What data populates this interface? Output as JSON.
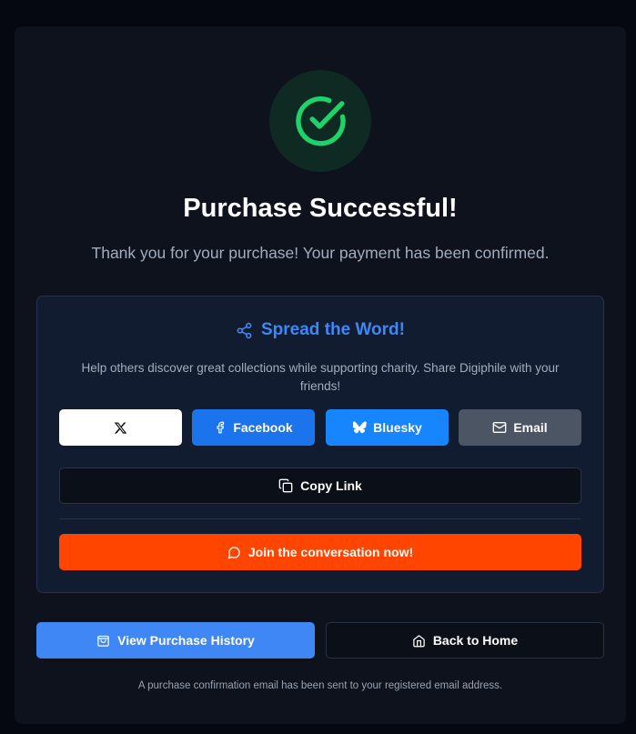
{
  "colors": {
    "success": "#1fd26a",
    "accent_blue": "#3f87f5",
    "facebook": "#1c74ec",
    "bluesky": "#1785fe",
    "email": "#4b5563",
    "join": "#ff4500"
  },
  "header": {
    "icon": "check-circle-icon",
    "title": "Purchase Successful!",
    "subtitle": "Thank you for your purchase! Your payment has been confirmed."
  },
  "share": {
    "icon": "share-icon",
    "title": "Spread the Word!",
    "description": "Help others discover great collections while supporting charity. Share Digiphile with your friends!",
    "buttons": {
      "x": {
        "icon": "x-logo-icon"
      },
      "facebook": {
        "label": "Facebook",
        "icon": "facebook-icon"
      },
      "bluesky": {
        "label": "Bluesky",
        "icon": "butterfly-icon"
      },
      "email": {
        "label": "Email",
        "icon": "mail-icon"
      }
    },
    "copy_link": {
      "label": "Copy Link",
      "icon": "copy-icon"
    },
    "join": {
      "label": "Join the conversation now!",
      "icon": "chat-bubble-icon"
    }
  },
  "actions": {
    "history": {
      "label": "View Purchase History",
      "icon": "shopping-bag-icon"
    },
    "home": {
      "label": "Back to Home",
      "icon": "home-icon"
    }
  },
  "footnote": "A purchase confirmation email has been sent to your registered email address."
}
